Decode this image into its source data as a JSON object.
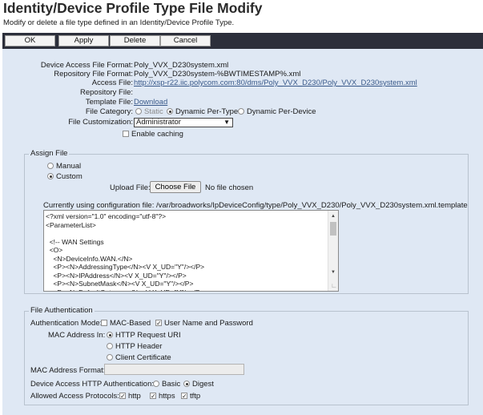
{
  "header": {
    "title": "Identity/Device Profile Type File Modify",
    "subtitle": "Modify or delete a file type defined in an Identity/Device Profile Type."
  },
  "toolbar": {
    "ok": "OK",
    "apply": "Apply",
    "delete": "Delete",
    "cancel": "Cancel"
  },
  "info": {
    "device_access_file_format": {
      "label": "Device Access File Format:",
      "value": "Poly_VVX_D230system.xml"
    },
    "repository_file_format": {
      "label": "Repository File Format:",
      "value": "Poly_VVX_D230system-%BWTIMESTAMP%.xml"
    },
    "access_file": {
      "label": "Access File:",
      "value": "http://xsp-r22.iic.polycom.com:80/dms/Poly_VVX_D230/Poly_VVX_D230system.xml"
    },
    "repository_file": {
      "label": "Repository File:",
      "value": ""
    },
    "template_file": {
      "label": "Template File:",
      "value": "Download"
    },
    "file_category": {
      "label": "File Category:",
      "options": [
        "Static",
        "Dynamic Per-Type",
        "Dynamic Per-Device"
      ],
      "selected": "Dynamic Per-Type"
    },
    "file_customization": {
      "label": "File Customization:",
      "value": "Administrator",
      "arrow": "▼"
    },
    "enable_caching": {
      "label": "Enable caching",
      "checked": false
    }
  },
  "assign_file": {
    "legend": "Assign File",
    "manual": "Manual",
    "custom": "Custom",
    "selected": "Custom",
    "upload_label": "Upload File:",
    "choose_button": "Choose File",
    "no_file": "No file chosen",
    "config_label": "Currently using configuration file: /var/broadworks/IpDeviceConfig/type/Poly_VVX_D230/Poly_VVX_D230system.xml.template",
    "template_lines": [
      "<?xml version=\"1.0\" encoding=\"utf-8\"?>",
      "<ParameterList>",
      "",
      "  <!-- WAN Settings",
      "  <O>",
      "    <N>DeviceInfo.WAN.</N>",
      "    <P><N>AddressingType</N><V X_UD=\"Y\"/></P>",
      "    <P><N>IPAddress</N><V X_UD=\"Y\"/></P>",
      "    <P><N>SubnetMask</N><V X_UD=\"Y\"/></P>",
      "    <P><N>DefaultGateway</N><V X_UD=\"Y\"/></P>"
    ]
  },
  "file_auth": {
    "legend": "File Authentication",
    "mode_label": "Authentication Mode:",
    "mac_based": {
      "label": "MAC-Based",
      "checked": false
    },
    "user_pass": {
      "label": "User Name and Password",
      "checked": true
    },
    "mac_in_label": "MAC Address In:",
    "mac_in_options": [
      "HTTP Request URI",
      "HTTP Header",
      "Client Certificate"
    ],
    "mac_in_selected": "HTTP Request URI",
    "mac_format_label": "MAC Address Format:",
    "mac_format_value": "",
    "http_auth_label": "Device Access HTTP Authentication:",
    "http_auth_options": [
      "Basic",
      "Digest"
    ],
    "http_auth_selected": "Digest",
    "protocols_label": "Allowed Access Protocols:",
    "protocols": [
      {
        "label": "http",
        "checked": true
      },
      {
        "label": "https",
        "checked": true
      },
      {
        "label": "tftp",
        "checked": true
      }
    ]
  }
}
